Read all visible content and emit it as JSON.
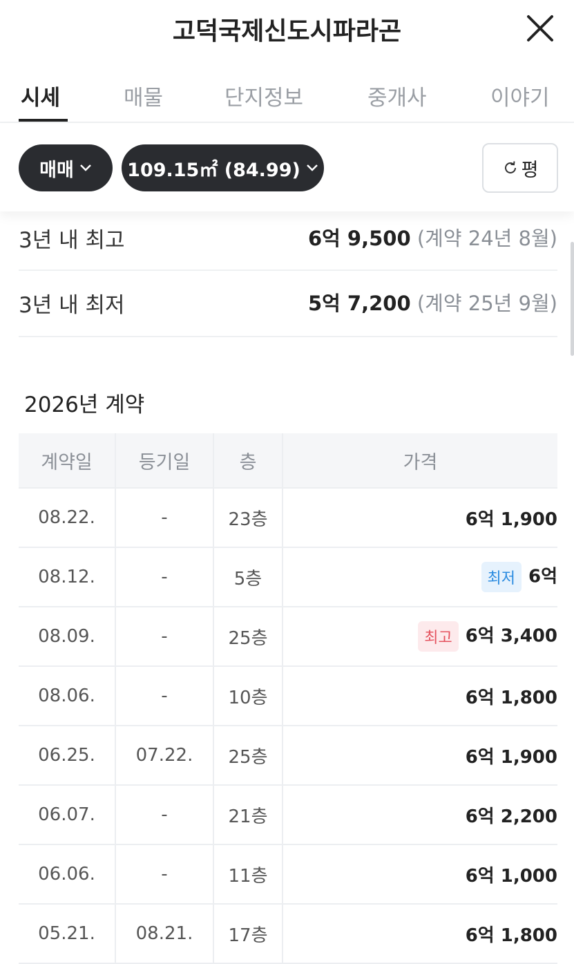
{
  "header": {
    "title": "고덕국제신도시파라곤"
  },
  "tabs": [
    {
      "label": "시세"
    },
    {
      "label": "매물"
    },
    {
      "label": "단지정보"
    },
    {
      "label": "중개사"
    },
    {
      "label": "이야기"
    }
  ],
  "filters": {
    "trade_type": "매매",
    "area": "109.15㎡ (84.99)",
    "unit_label": "평"
  },
  "stats": [
    {
      "label": "3년 내 최고",
      "price": "6억 9,500",
      "note": "(계약 24년 8월)"
    },
    {
      "label": "3년 내 최저",
      "price": "5억 7,200",
      "note": "(계약 25년 9월)"
    }
  ],
  "section_title": "2026년 계약",
  "table": {
    "headers": [
      "계약일",
      "등기일",
      "층",
      "가격"
    ],
    "rows": [
      {
        "date": "08.22.",
        "reg": "-",
        "floor": "23층",
        "badge": "",
        "price": "6억 1,900"
      },
      {
        "date": "08.12.",
        "reg": "-",
        "floor": "5층",
        "badge": "최저",
        "price": "6억"
      },
      {
        "date": "08.09.",
        "reg": "-",
        "floor": "25층",
        "badge": "최고",
        "price": "6억 3,400"
      },
      {
        "date": "08.06.",
        "reg": "-",
        "floor": "10층",
        "badge": "",
        "price": "6억 1,800"
      },
      {
        "date": "06.25.",
        "reg": "07.22.",
        "floor": "25층",
        "badge": "",
        "price": "6억 1,900"
      },
      {
        "date": "06.07.",
        "reg": "-",
        "floor": "21층",
        "badge": "",
        "price": "6억 2,200"
      },
      {
        "date": "06.06.",
        "reg": "-",
        "floor": "11층",
        "badge": "",
        "price": "6억 1,000"
      },
      {
        "date": "05.21.",
        "reg": "08.21.",
        "floor": "17층",
        "badge": "",
        "price": "6억 1,800"
      }
    ]
  },
  "colors": {
    "chip_bg": "#2a2c30",
    "low_badge": "#2a8be0",
    "high_badge": "#e5525e"
  },
  "icons": {
    "close": "close-icon",
    "chevron": "chevron-down-icon",
    "refresh": "refresh-icon"
  }
}
